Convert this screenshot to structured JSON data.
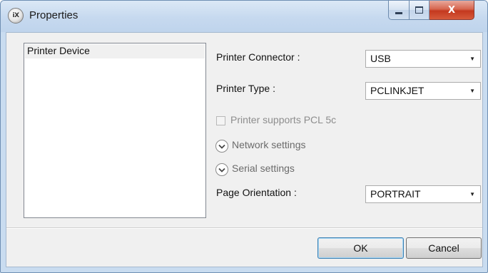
{
  "window": {
    "title": "Properties",
    "app_icon_text": "iX",
    "controls": {
      "close_glyph": "X"
    }
  },
  "device_list": {
    "items": [
      "Printer Device"
    ],
    "selected": "Printer Device"
  },
  "form": {
    "printer_connector": {
      "label": "Printer Connector :",
      "value": "USB"
    },
    "printer_type": {
      "label": "Printer Type :",
      "value": "PCLINKJET"
    },
    "pcl5c": {
      "label": "Printer supports PCL 5c",
      "checked": false,
      "enabled": false
    },
    "network_settings": {
      "label": "Network settings",
      "expanded": false
    },
    "serial_settings": {
      "label": "Serial settings",
      "expanded": false
    },
    "page_orientation": {
      "label": "Page Orientation :",
      "value": "PORTRAIT"
    }
  },
  "buttons": {
    "ok": "OK",
    "cancel": "Cancel"
  }
}
